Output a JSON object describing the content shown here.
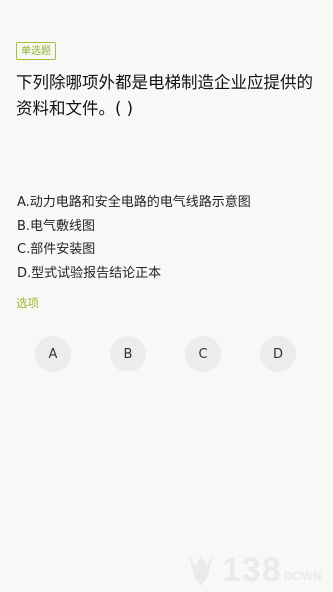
{
  "question": {
    "type_label": "单选题",
    "text": "下列除哪项外都是电梯制造企业应提供的资料和文件。( )"
  },
  "options": [
    "A.动力电路和安全电路的电气线路示意图",
    "B.电气敷线图",
    "C.部件安装图",
    "D.型式试验报告结论正本"
  ],
  "choices_label": "选项",
  "choices": [
    "A",
    "B",
    "C",
    "D"
  ],
  "watermark": {
    "number": "138",
    "word": "DOWN"
  },
  "colors": {
    "accent": "#9cbb35",
    "choice_bg": "#ececec",
    "background": "#f8f8f6"
  }
}
